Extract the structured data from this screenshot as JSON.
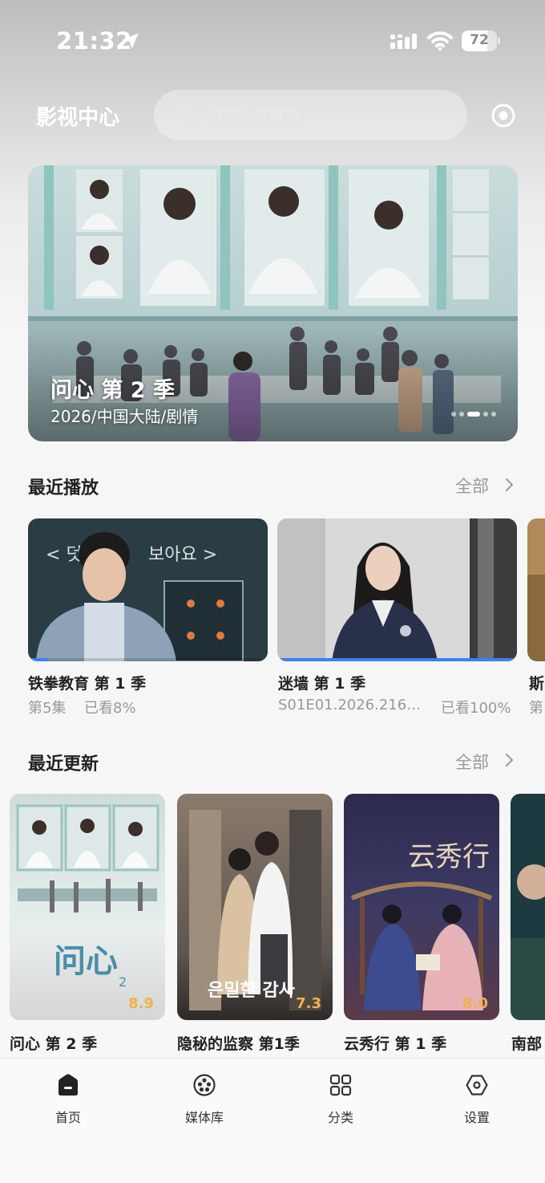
{
  "status_bar": {
    "time": "21:32",
    "battery": "72",
    "battery_level": 0.72
  },
  "header": {
    "title": "影视中心",
    "search_placeholder": "请输入关键词"
  },
  "banner": {
    "title": "问心 第 2 季",
    "subtitle": "2026/中国大陆/剧情",
    "dot_count": 5,
    "active_dot": 2
  },
  "recent_play": {
    "title": "最近播放",
    "see_all": "全部",
    "items": [
      {
        "title": "铁拳教育 第 1 季",
        "episode": "第5集",
        "progress_label": "已看8%",
        "progress": 0.08
      },
      {
        "title": "迷墙 第 1 季",
        "episode": "S01E01.2026.216…",
        "progress_label": "已看100%",
        "progress": 1.0
      },
      {
        "title": "斯",
        "episode": "第"
      }
    ]
  },
  "recent_update": {
    "title": "最近更新",
    "see_all": "全部",
    "items": [
      {
        "title": "问心 第 2 季",
        "rating": "8.9"
      },
      {
        "title": "隐秘的监察 第1季",
        "rating": "7.3"
      },
      {
        "title": "云秀行 第 1 季",
        "rating": "8.0"
      },
      {
        "title": "南部"
      }
    ]
  },
  "tabbar": {
    "items": [
      {
        "label": "首页",
        "icon": "home-icon",
        "active": true
      },
      {
        "label": "媒体库",
        "icon": "film-reel-icon"
      },
      {
        "label": "分类",
        "icon": "grid-icon"
      },
      {
        "label": "设置",
        "icon": "settings-hexagon-icon"
      }
    ]
  },
  "colors": {
    "accent": "#3f7ff0",
    "rating": "#f0b24a",
    "background": "#f7f7f7"
  }
}
